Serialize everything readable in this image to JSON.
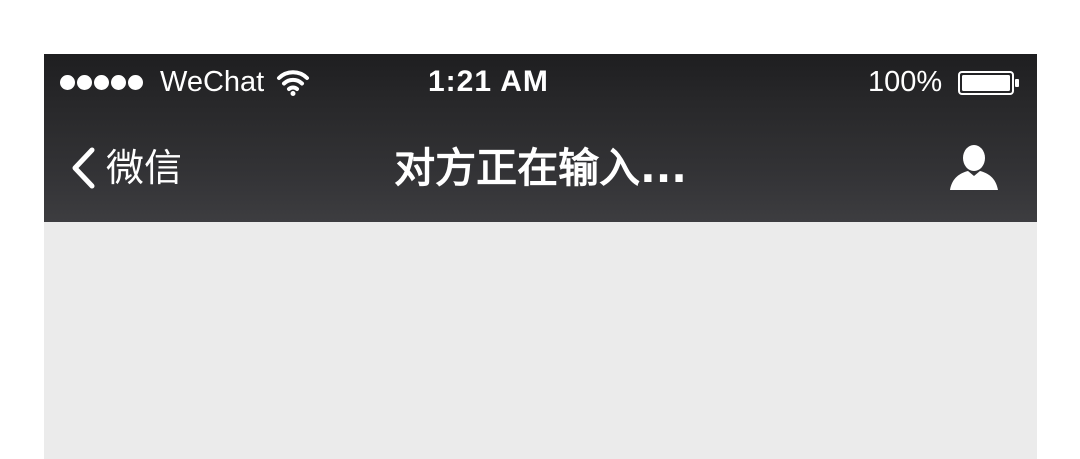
{
  "status_bar": {
    "signal_icon": "signal-dots-icon",
    "carrier": "WeChat",
    "wifi_icon": "wifi-icon",
    "time": "1:21 AM",
    "battery_percent": "100%",
    "battery_icon": "battery-icon",
    "battery_level": 1.0
  },
  "nav_bar": {
    "back_icon": "chevron-left-icon",
    "back_label": "微信",
    "title": "对方正在输入...",
    "profile_icon": "person-icon"
  },
  "colors": {
    "bar_background": "#2b2b2d",
    "chat_background": "#ebebeb",
    "bar_text": "#ffffff"
  }
}
